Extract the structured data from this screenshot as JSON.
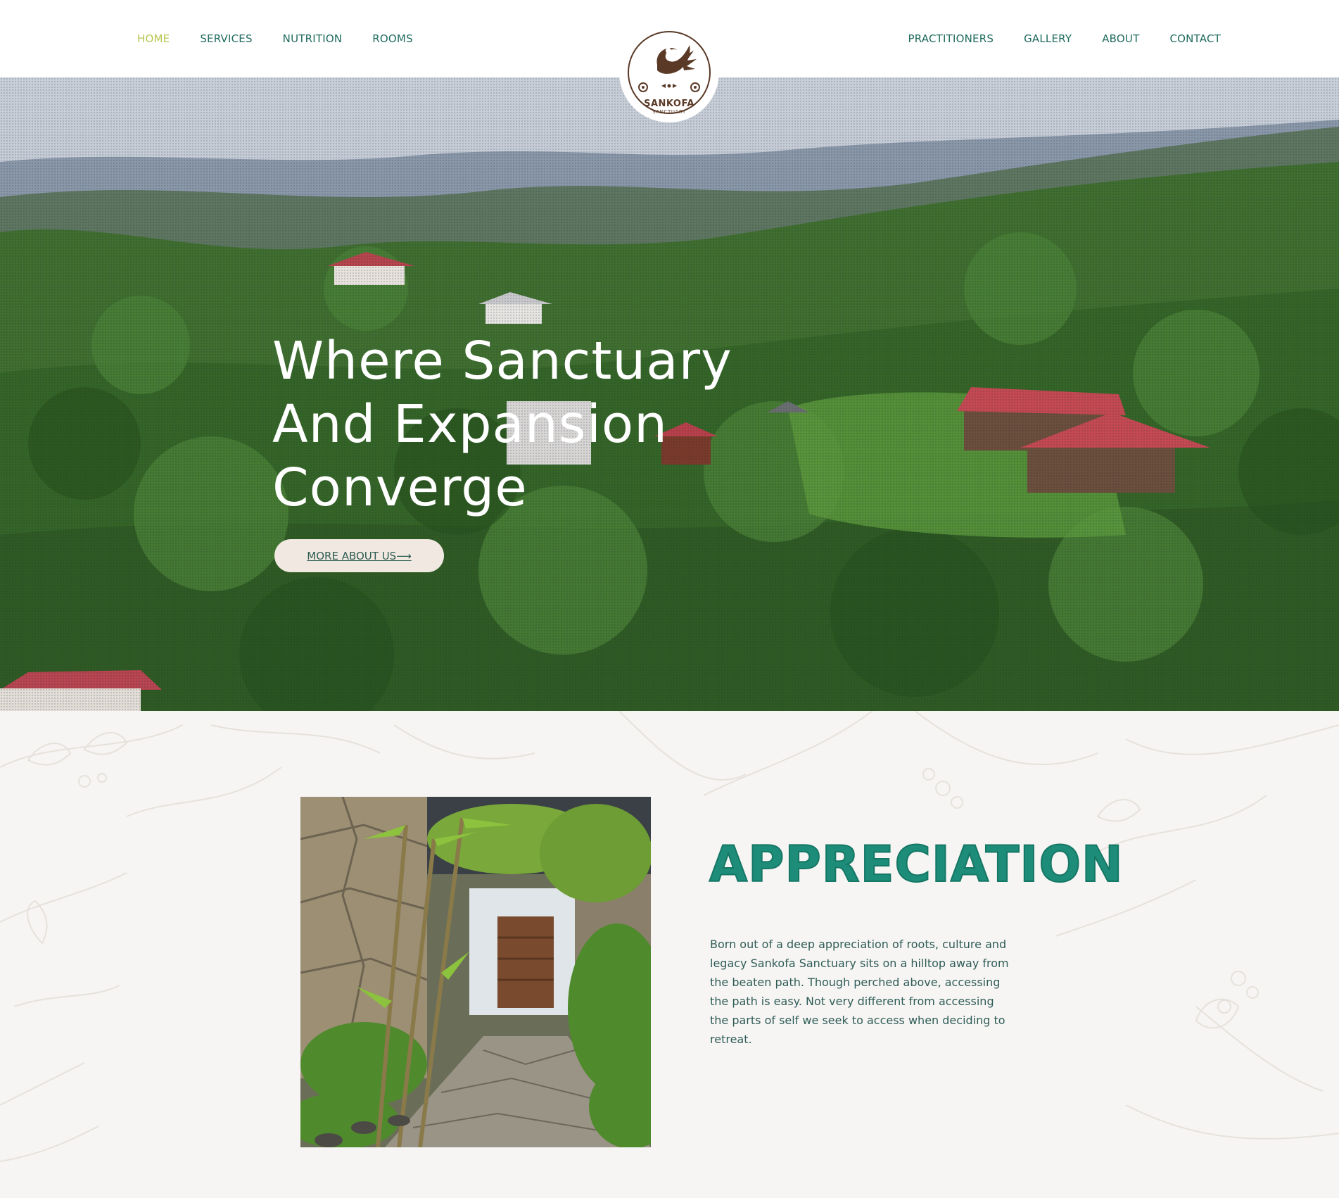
{
  "nav": {
    "left": [
      {
        "label": "HOME",
        "active": true
      },
      {
        "label": "SERVICES"
      },
      {
        "label": "NUTRITION"
      },
      {
        "label": "ROOMS"
      }
    ],
    "right": [
      {
        "label": "PRACTITIONERS"
      },
      {
        "label": "GALLERY"
      },
      {
        "label": "ABOUT"
      },
      {
        "label": "CONTACT"
      }
    ]
  },
  "logo": {
    "name": "SANKOFA",
    "sub": "SANCTUARY"
  },
  "hero": {
    "title_line1": "Where Sanctuary",
    "title_line2": "And Expansion",
    "title_line3": "Converge",
    "button": "MORE ABOUT US⟶"
  },
  "appreciation": {
    "heading": "APPRECIATION",
    "body": "Born out of a deep appreciation of roots, culture and legacy Sankofa Sanctuary sits on a hilltop away from the beaten path. Though perched above, accessing the path is easy. Not very different from accessing the parts of self we seek to access when deciding to retreat."
  },
  "colors": {
    "nav_text": "#1f6b5e",
    "nav_active": "#b8c653",
    "heading_teal": "#1d8c79",
    "logo_brown": "#5a3a27",
    "button_bg": "#f1e9e1"
  }
}
